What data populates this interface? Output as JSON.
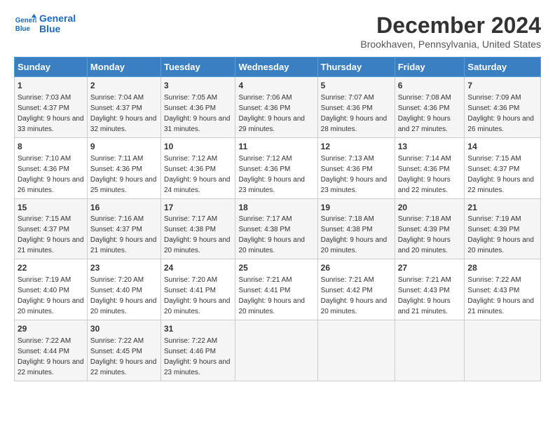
{
  "logo": {
    "line1": "General",
    "line2": "Blue"
  },
  "title": "December 2024",
  "subtitle": "Brookhaven, Pennsylvania, United States",
  "days_of_week": [
    "Sunday",
    "Monday",
    "Tuesday",
    "Wednesday",
    "Thursday",
    "Friday",
    "Saturday"
  ],
  "weeks": [
    [
      {
        "day": 1,
        "sunrise": "7:03 AM",
        "sunset": "4:37 PM",
        "daylight": "9 hours and 33 minutes."
      },
      {
        "day": 2,
        "sunrise": "7:04 AM",
        "sunset": "4:37 PM",
        "daylight": "9 hours and 32 minutes."
      },
      {
        "day": 3,
        "sunrise": "7:05 AM",
        "sunset": "4:36 PM",
        "daylight": "9 hours and 31 minutes."
      },
      {
        "day": 4,
        "sunrise": "7:06 AM",
        "sunset": "4:36 PM",
        "daylight": "9 hours and 29 minutes."
      },
      {
        "day": 5,
        "sunrise": "7:07 AM",
        "sunset": "4:36 PM",
        "daylight": "9 hours and 28 minutes."
      },
      {
        "day": 6,
        "sunrise": "7:08 AM",
        "sunset": "4:36 PM",
        "daylight": "9 hours and 27 minutes."
      },
      {
        "day": 7,
        "sunrise": "7:09 AM",
        "sunset": "4:36 PM",
        "daylight": "9 hours and 26 minutes."
      }
    ],
    [
      {
        "day": 8,
        "sunrise": "7:10 AM",
        "sunset": "4:36 PM",
        "daylight": "9 hours and 26 minutes."
      },
      {
        "day": 9,
        "sunrise": "7:11 AM",
        "sunset": "4:36 PM",
        "daylight": "9 hours and 25 minutes."
      },
      {
        "day": 10,
        "sunrise": "7:12 AM",
        "sunset": "4:36 PM",
        "daylight": "9 hours and 24 minutes."
      },
      {
        "day": 11,
        "sunrise": "7:12 AM",
        "sunset": "4:36 PM",
        "daylight": "9 hours and 23 minutes."
      },
      {
        "day": 12,
        "sunrise": "7:13 AM",
        "sunset": "4:36 PM",
        "daylight": "9 hours and 23 minutes."
      },
      {
        "day": 13,
        "sunrise": "7:14 AM",
        "sunset": "4:36 PM",
        "daylight": "9 hours and 22 minutes."
      },
      {
        "day": 14,
        "sunrise": "7:15 AM",
        "sunset": "4:37 PM",
        "daylight": "9 hours and 22 minutes."
      }
    ],
    [
      {
        "day": 15,
        "sunrise": "7:15 AM",
        "sunset": "4:37 PM",
        "daylight": "9 hours and 21 minutes."
      },
      {
        "day": 16,
        "sunrise": "7:16 AM",
        "sunset": "4:37 PM",
        "daylight": "9 hours and 21 minutes."
      },
      {
        "day": 17,
        "sunrise": "7:17 AM",
        "sunset": "4:38 PM",
        "daylight": "9 hours and 20 minutes."
      },
      {
        "day": 18,
        "sunrise": "7:17 AM",
        "sunset": "4:38 PM",
        "daylight": "9 hours and 20 minutes."
      },
      {
        "day": 19,
        "sunrise": "7:18 AM",
        "sunset": "4:38 PM",
        "daylight": "9 hours and 20 minutes."
      },
      {
        "day": 20,
        "sunrise": "7:18 AM",
        "sunset": "4:39 PM",
        "daylight": "9 hours and 20 minutes."
      },
      {
        "day": 21,
        "sunrise": "7:19 AM",
        "sunset": "4:39 PM",
        "daylight": "9 hours and 20 minutes."
      }
    ],
    [
      {
        "day": 22,
        "sunrise": "7:19 AM",
        "sunset": "4:40 PM",
        "daylight": "9 hours and 20 minutes."
      },
      {
        "day": 23,
        "sunrise": "7:20 AM",
        "sunset": "4:40 PM",
        "daylight": "9 hours and 20 minutes."
      },
      {
        "day": 24,
        "sunrise": "7:20 AM",
        "sunset": "4:41 PM",
        "daylight": "9 hours and 20 minutes."
      },
      {
        "day": 25,
        "sunrise": "7:21 AM",
        "sunset": "4:41 PM",
        "daylight": "9 hours and 20 minutes."
      },
      {
        "day": 26,
        "sunrise": "7:21 AM",
        "sunset": "4:42 PM",
        "daylight": "9 hours and 20 minutes."
      },
      {
        "day": 27,
        "sunrise": "7:21 AM",
        "sunset": "4:43 PM",
        "daylight": "9 hours and 21 minutes."
      },
      {
        "day": 28,
        "sunrise": "7:22 AM",
        "sunset": "4:43 PM",
        "daylight": "9 hours and 21 minutes."
      }
    ],
    [
      {
        "day": 29,
        "sunrise": "7:22 AM",
        "sunset": "4:44 PM",
        "daylight": "9 hours and 22 minutes."
      },
      {
        "day": 30,
        "sunrise": "7:22 AM",
        "sunset": "4:45 PM",
        "daylight": "9 hours and 22 minutes."
      },
      {
        "day": 31,
        "sunrise": "7:22 AM",
        "sunset": "4:46 PM",
        "daylight": "9 hours and 23 minutes."
      },
      null,
      null,
      null,
      null
    ]
  ],
  "labels": {
    "sunrise": "Sunrise:",
    "sunset": "Sunset:",
    "daylight": "Daylight:"
  }
}
